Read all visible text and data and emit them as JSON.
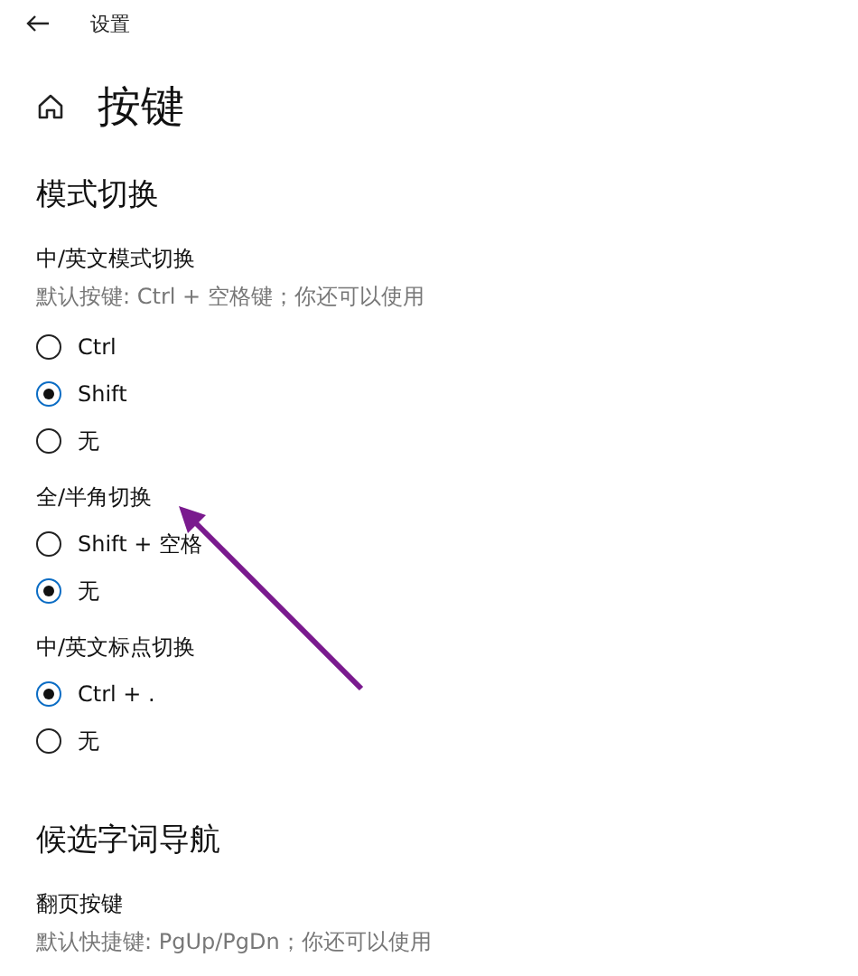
{
  "header": {
    "title": "设置"
  },
  "page": {
    "title": "按键"
  },
  "sections": [
    {
      "heading": "模式切换",
      "groups": [
        {
          "label": "中/英文模式切换",
          "description": "默认按键: Ctrl + 空格键；你还可以使用",
          "options": [
            {
              "label": "Ctrl",
              "selected": false
            },
            {
              "label": "Shift",
              "selected": true
            },
            {
              "label": "无",
              "selected": false
            }
          ]
        },
        {
          "label": "全/半角切换",
          "options": [
            {
              "label": "Shift + 空格",
              "selected": false
            },
            {
              "label": "无",
              "selected": true
            }
          ]
        },
        {
          "label": "中/英文标点切换",
          "options": [
            {
              "label": "Ctrl + .",
              "selected": true
            },
            {
              "label": "无",
              "selected": false
            }
          ]
        }
      ]
    },
    {
      "heading": "候选字词导航",
      "groups": [
        {
          "label": "翻页按键",
          "description": "默认快捷键: PgUp/PgDn；你还可以使用"
        }
      ]
    }
  ],
  "annotation": {
    "kind": "arrow"
  }
}
